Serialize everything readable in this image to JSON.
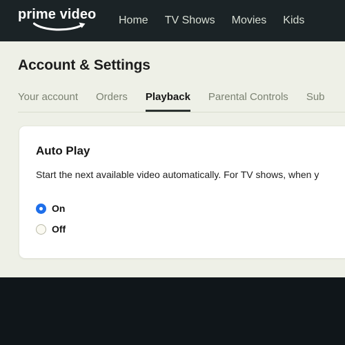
{
  "brand": {
    "logo_text": "prime video",
    "logo_icon": "amazon-smile-arrow-icon"
  },
  "nav": {
    "items": [
      {
        "label": "Home"
      },
      {
        "label": "TV Shows"
      },
      {
        "label": "Movies"
      },
      {
        "label": "Kids"
      }
    ]
  },
  "page": {
    "title": "Account & Settings"
  },
  "tabs": [
    {
      "label": "Your account",
      "active": false
    },
    {
      "label": "Orders",
      "active": false
    },
    {
      "label": "Playback",
      "active": true
    },
    {
      "label": "Parental Controls",
      "active": false
    },
    {
      "label": "Sub",
      "active": false
    }
  ],
  "auto_play": {
    "title": "Auto Play",
    "description": "Start the next available video automatically. For TV shows, when y",
    "options": [
      {
        "label": "On",
        "selected": true
      },
      {
        "label": "Off",
        "selected": false
      }
    ]
  },
  "colors": {
    "topbar_bg": "#1b2326",
    "page_bg": "#eef0e7",
    "card_bg": "#ffffff",
    "footer_bg": "#10161a",
    "accent_radio": "#1f6fea",
    "tab_active_underline": "#2b3230",
    "tab_inactive_text": "#7b8272"
  }
}
